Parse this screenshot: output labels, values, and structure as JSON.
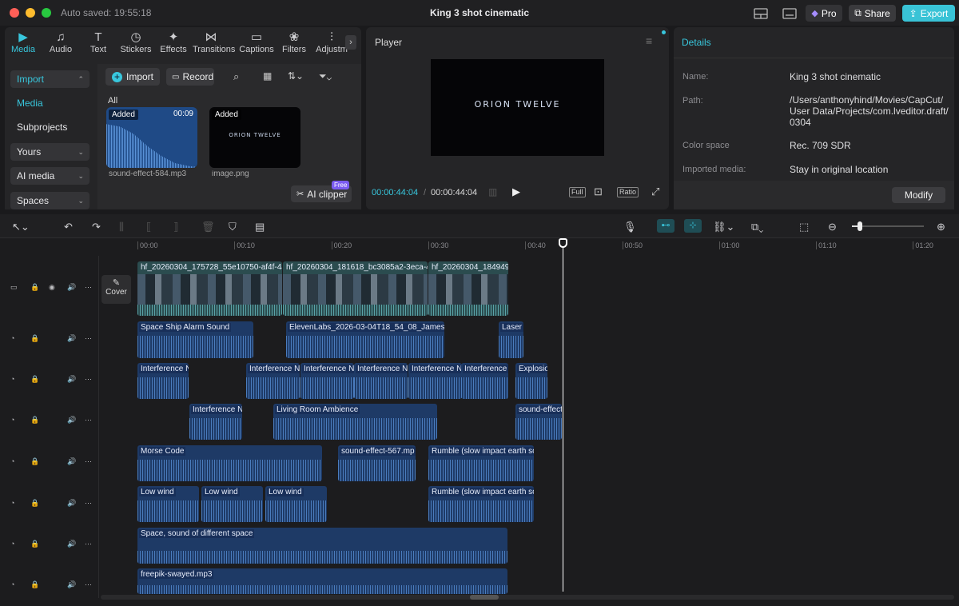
{
  "titlebar": {
    "autosave": "Auto saved: 19:55:18",
    "title": "King 3 shot cinematic",
    "pro_label": "Pro",
    "share_label": "Share",
    "export_label": "Export"
  },
  "media_panel": {
    "tabs": [
      {
        "label": "Media",
        "icon": "media-icon"
      },
      {
        "label": "Audio",
        "icon": "audio-icon"
      },
      {
        "label": "Text",
        "icon": "text-icon"
      },
      {
        "label": "Stickers",
        "icon": "stickers-icon"
      },
      {
        "label": "Effects",
        "icon": "effects-icon"
      },
      {
        "label": "Transitions",
        "icon": "transitions-icon"
      },
      {
        "label": "Captions",
        "icon": "captions-icon"
      },
      {
        "label": "Filters",
        "icon": "filters-icon"
      },
      {
        "label": "Adjustm",
        "icon": "adjustment-icon"
      }
    ],
    "sidebar": [
      {
        "label": "Import"
      },
      {
        "label": "Media"
      },
      {
        "label": "Subprojects"
      },
      {
        "label": "Yours"
      },
      {
        "label": "AI media"
      },
      {
        "label": "Spaces"
      }
    ],
    "import_label": "Import",
    "record_label": "Record",
    "section_label": "All",
    "items": [
      {
        "badge": "Added",
        "duration": "00:09",
        "name": "sound-effect-584.mp3"
      },
      {
        "badge": "Added",
        "duration": "",
        "name": "image.png",
        "logo_text": "ORION TWELVE"
      }
    ],
    "ai_clipper_label": "AI clipper",
    "free_badge": "Free"
  },
  "player": {
    "title": "Player",
    "preview_text": "ORION TWELVE",
    "current_time": "00:00:44:04",
    "total_time": "00:00:44:04",
    "full_label": "Full",
    "ratio_label": "Ratio"
  },
  "details": {
    "title": "Details",
    "rows": [
      {
        "label": "Name:",
        "value": "King 3 shot cinematic"
      },
      {
        "label": "Path:",
        "value": "/Users/anthonyhind/Movies/CapCut/ User Data/Projects/com.lveditor.draft/ 0304"
      },
      {
        "label": "Color space",
        "value": "Rec. 709 SDR"
      },
      {
        "label": "Imported media:",
        "value": "Stay in original location"
      }
    ],
    "modify_label": "Modify"
  },
  "timeline": {
    "ruler": [
      "00:00",
      "00:10",
      "00:20",
      "00:30",
      "00:40",
      "00:50",
      "01:00",
      "01:10",
      "01:20"
    ],
    "cover_label": "Cover",
    "video_clips": [
      {
        "name": "hf_20260304_175728_55e10750-af4f-4a"
      },
      {
        "name": "hf_20260304_181618_bc3085a2-3eca-4"
      },
      {
        "name": "hf_20260304_184949"
      }
    ],
    "audio_tracks": [
      [
        {
          "name": "Space Ship Alarm Sound"
        },
        {
          "name": "ElevenLabs_2026-03-04T18_54_08_James -"
        },
        {
          "name": "Laser G"
        }
      ],
      [
        {
          "name": "Interference N"
        },
        {
          "name": "Interference N"
        },
        {
          "name": "Interference N"
        },
        {
          "name": "Interference N"
        },
        {
          "name": "Interference N"
        },
        {
          "name": "Interference"
        },
        {
          "name": "Explosio"
        }
      ],
      [
        {
          "name": "Interference N"
        },
        {
          "name": "Living Room Ambience"
        },
        {
          "name": "sound-effect"
        }
      ],
      [
        {
          "name": "Morse Code"
        },
        {
          "name": "sound-effect-567.mp"
        },
        {
          "name": "Rumble (slow impact earth so"
        }
      ],
      [
        {
          "name": "Low wind"
        },
        {
          "name": "Low wind"
        },
        {
          "name": "Low wind"
        },
        {
          "name": "Rumble (slow impact earth so"
        }
      ],
      [
        {
          "name": "Space, sound of different space"
        }
      ],
      [
        {
          "name": "freepik-swayed.mp3"
        }
      ]
    ]
  }
}
